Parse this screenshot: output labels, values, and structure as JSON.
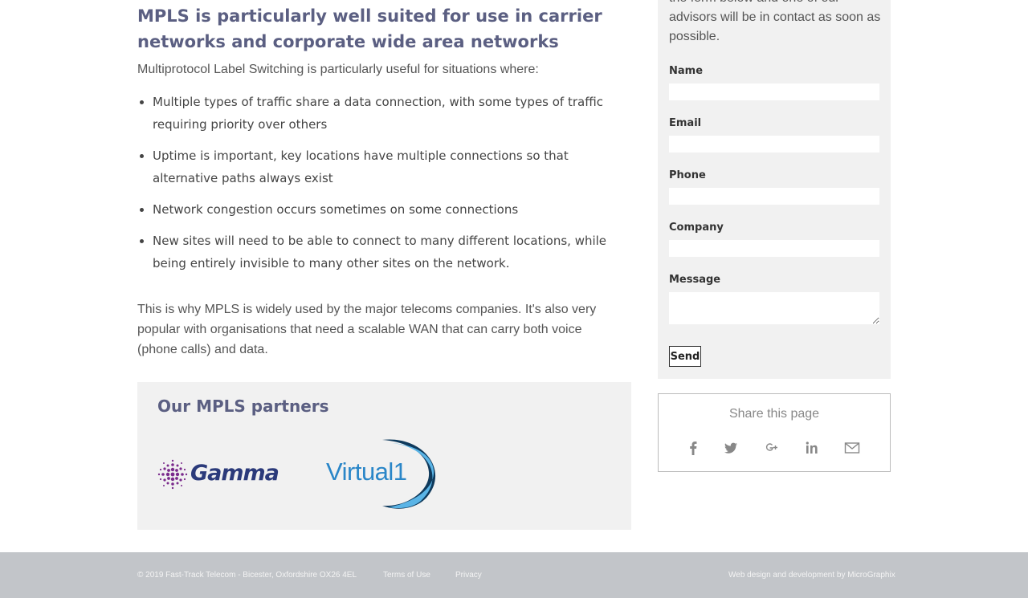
{
  "article": {
    "heading": "MPLS is particularly well suited for use in carrier networks and corporate wide area networks",
    "intro": "Multiprotocol Label Switching is particularly useful for situations where:",
    "bullets": [
      "Multiple types of traffic share a data connection, with some types of traffic requiring priority over others",
      "Uptime is important, key locations have multiple connections so that alternative paths always exist",
      "Network congestion occurs sometimes on some connections",
      "New sites will need to be able to connect to many different locations, while being entirely invisible to many other sites on the network."
    ],
    "paragraph": "This is why MPLS is widely used by the major telecoms companies. It's also very popular with organisations that need a scalable WAN that can carry both voice (phone calls) and data."
  },
  "partners": {
    "title": "Our MPLS partners",
    "logos": [
      {
        "name": "Gamma",
        "icon": "gamma-logo"
      },
      {
        "name": "Virtual1",
        "icon": "virtual1-logo"
      }
    ]
  },
  "contact_form": {
    "intro": "the form below and one of our advisors will be in contact as soon as possible.",
    "fields": {
      "name": {
        "label": "Name",
        "value": ""
      },
      "email": {
        "label": "Email",
        "value": ""
      },
      "phone": {
        "label": "Phone",
        "value": ""
      },
      "company": {
        "label": "Company",
        "value": ""
      },
      "message": {
        "label": "Message",
        "value": ""
      }
    },
    "send_label": "Send"
  },
  "share": {
    "title": "Share this page",
    "icons": [
      "facebook-icon",
      "twitter-icon",
      "google-plus-icon",
      "linkedin-icon",
      "email-icon"
    ]
  },
  "footer": {
    "copyright": "© 2019 Fast-Track Telecom - Bicester, Oxfordshire OX26 4EL",
    "terms": "Terms of Use",
    "privacy": "Privacy",
    "credit": "Web design and development by MicroGraphix"
  },
  "colors": {
    "heading": "#5b5f82",
    "panel_bg": "#f1f1f1",
    "footer_bg": "#c2c5c9",
    "gamma_purple": "#7a2a8c",
    "virtual_blue": "#2a86c8"
  }
}
